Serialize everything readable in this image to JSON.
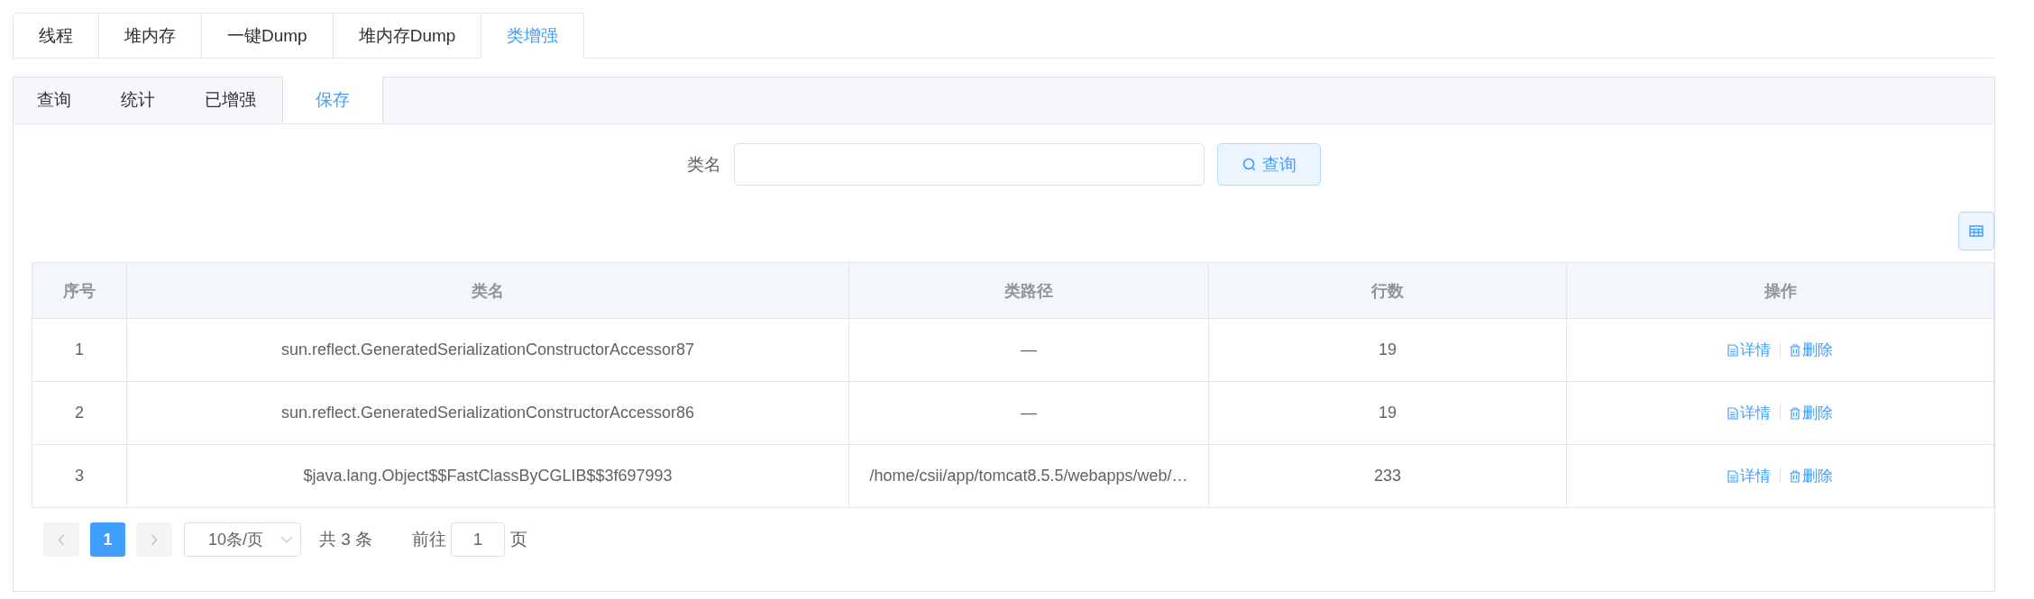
{
  "top_tabs": [
    {
      "label": "线程",
      "selected": false
    },
    {
      "label": "堆内存",
      "selected": false
    },
    {
      "label": "一键Dump",
      "selected": false
    },
    {
      "label": "堆内存Dump",
      "selected": false
    },
    {
      "label": "类增强",
      "selected": true
    }
  ],
  "sub_tabs": [
    {
      "label": "查询",
      "selected": false
    },
    {
      "label": "统计",
      "selected": false
    },
    {
      "label": "已增强",
      "selected": false
    },
    {
      "label": "保存",
      "selected": true
    }
  ],
  "search": {
    "label": "类名",
    "button": "查询"
  },
  "table": {
    "columns": [
      "序号",
      "类名",
      "类路径",
      "行数",
      "操作"
    ],
    "rows": [
      {
        "cells": [
          "1",
          "sun.reflect.GeneratedSerializationConstructorAccessor87",
          "—",
          "19"
        ],
        "actions": [
          "详情",
          "删除"
        ]
      },
      {
        "cells": [
          "2",
          "sun.reflect.GeneratedSerializationConstructorAccessor86",
          "—",
          "19"
        ],
        "actions": [
          "详情",
          "删除"
        ]
      },
      {
        "cells": [
          "3",
          "$java.lang.Object$$FastClassByCGLIB$$3f697993",
          "/home/csii/app/tomcat8.5.5/webapps/web/…",
          "233"
        ],
        "actions": [
          "详情",
          "删除"
        ]
      }
    ]
  },
  "pagination": {
    "pages": [
      {
        "label": "1",
        "selected": true
      }
    ],
    "page_size": "10条/页",
    "total": "共 3 条",
    "goto_label": "前往",
    "goto_value": "1",
    "goto_suffix": "页"
  }
}
